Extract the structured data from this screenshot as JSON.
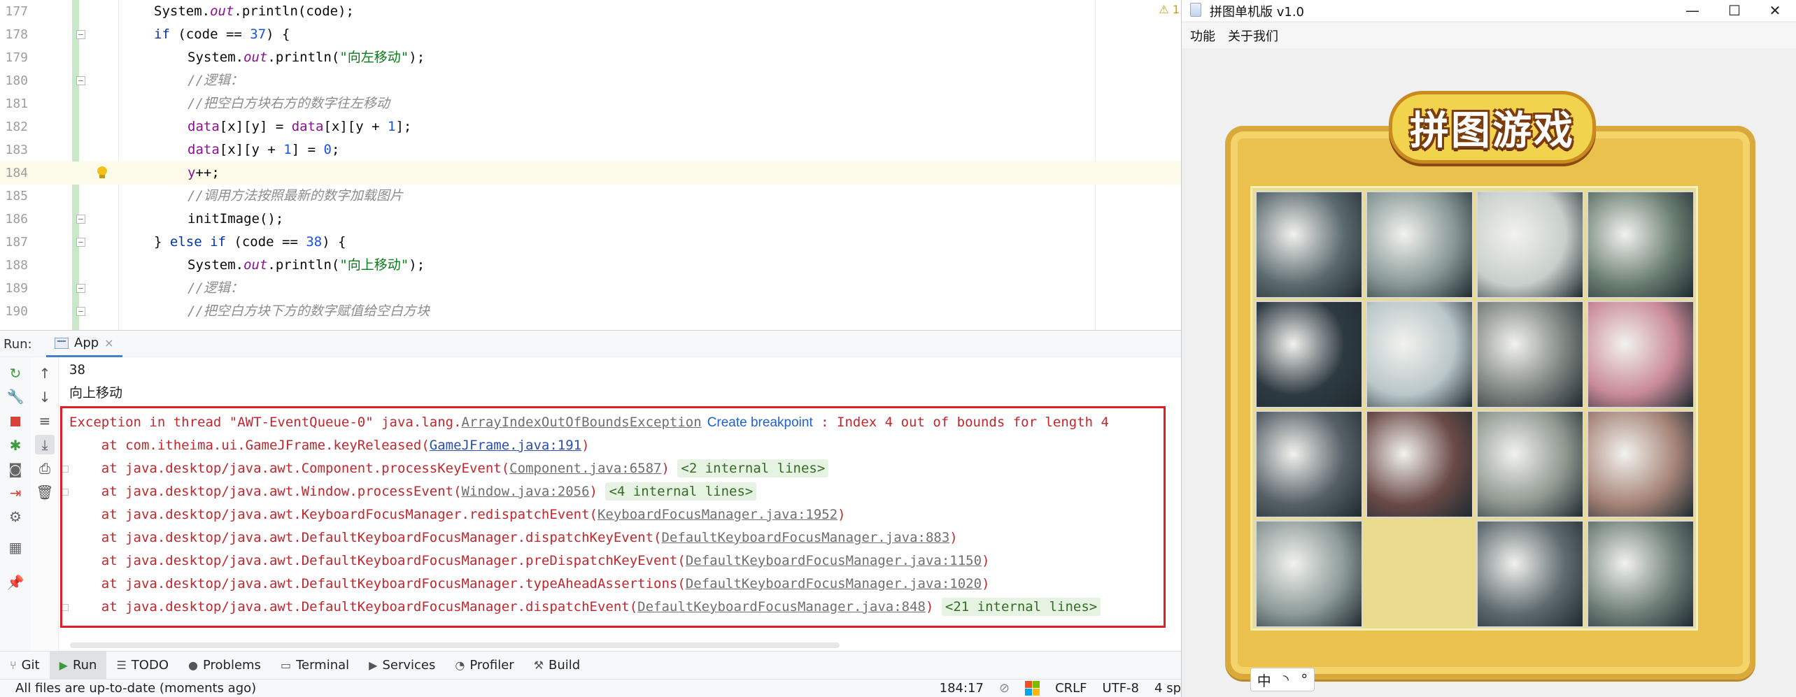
{
  "editor": {
    "lines": [
      {
        "no": "177",
        "indent": 1,
        "parts": [
          [
            "",
            "System."
          ],
          [
            "fld",
            "out"
          ],
          [
            "",
            ".println(code);"
          ]
        ]
      },
      {
        "no": "178",
        "indent": 1,
        "parts": [
          [
            "kw",
            "if"
          ],
          [
            "",
            " (code == "
          ],
          [
            "num",
            "37"
          ],
          [
            "",
            ") {"
          ]
        ],
        "fold": true
      },
      {
        "no": "179",
        "indent": 2,
        "parts": [
          [
            "",
            "System."
          ],
          [
            "fld",
            "out"
          ],
          [
            "",
            ".println("
          ],
          [
            "str",
            "\"向左移动\""
          ],
          [
            "",
            ");"
          ]
        ]
      },
      {
        "no": "180",
        "indent": 2,
        "parts": [
          [
            "cmt",
            "//逻辑："
          ]
        ],
        "fold": true
      },
      {
        "no": "181",
        "indent": 2,
        "parts": [
          [
            "cmt",
            "//把空白方块右方的数字往左移动"
          ]
        ]
      },
      {
        "no": "182",
        "indent": 2,
        "parts": [
          [
            "var",
            "data"
          ],
          [
            "",
            "[x][y] = "
          ],
          [
            "var",
            "data"
          ],
          [
            "",
            "[x][y + "
          ],
          [
            "num",
            "1"
          ],
          [
            "",
            "];"
          ]
        ]
      },
      {
        "no": "183",
        "indent": 2,
        "parts": [
          [
            "var",
            "data"
          ],
          [
            "",
            "[x][y + "
          ],
          [
            "num",
            "1"
          ],
          [
            "",
            "] = "
          ],
          [
            "num",
            "0"
          ],
          [
            "",
            ";"
          ]
        ]
      },
      {
        "no": "184",
        "indent": 2,
        "parts": [
          [
            "var",
            "y"
          ],
          [
            "",
            "++;"
          ]
        ],
        "highlight": true,
        "bulb": true
      },
      {
        "no": "185",
        "indent": 2,
        "parts": [
          [
            "cmt",
            "//调用方法按照最新的数字加载图片"
          ]
        ]
      },
      {
        "no": "186",
        "indent": 2,
        "parts": [
          [
            "",
            "initImage();"
          ]
        ],
        "fold": true
      },
      {
        "no": "187",
        "indent": 1,
        "parts": [
          [
            "",
            "} "
          ],
          [
            "kw",
            "else if"
          ],
          [
            "",
            " (code == "
          ],
          [
            "num",
            "38"
          ],
          [
            "",
            ") {"
          ]
        ],
        "fold": true
      },
      {
        "no": "188",
        "indent": 2,
        "parts": [
          [
            "",
            "System."
          ],
          [
            "fld",
            "out"
          ],
          [
            "",
            ".println("
          ],
          [
            "str",
            "\"向上移动\""
          ],
          [
            "",
            ");"
          ]
        ]
      },
      {
        "no": "189",
        "indent": 2,
        "parts": [
          [
            "cmt",
            "//逻辑："
          ]
        ],
        "fold": true
      },
      {
        "no": "190",
        "indent": 2,
        "parts": [
          [
            "cmt",
            "//把空白方块下方的数字赋值给空白方块"
          ]
        ],
        "fold": true
      }
    ],
    "warning_badge": "⚠ 1"
  },
  "run_panel": {
    "label": "Run:",
    "tab_label": "App",
    "close": "×"
  },
  "console": {
    "plain_lines": [
      "38",
      "向上移动"
    ],
    "exception": {
      "prefix": "Exception in thread \"AWT-EventQueue-0\" java.lang.",
      "exception_class": "ArrayIndexOutOfBoundsException",
      "create_breakpoint": "Create breakpoint",
      "message": " : Index 4 out of bounds for length 4"
    },
    "stack": [
      {
        "text": "    at com.itheima.ui.GameJFrame.keyReleased(",
        "link": "GameJFrame.java:191",
        "tail": ")",
        "internal": "",
        "blue": true
      },
      {
        "text": "    at java.desktop/java.awt.Component.processKeyEvent(",
        "link": "Component.java:6587",
        "tail": ") ",
        "internal": "<2 internal lines>",
        "fold": true
      },
      {
        "text": "    at java.desktop/java.awt.Window.processEvent(",
        "link": "Window.java:2056",
        "tail": ") ",
        "internal": "<4 internal lines>",
        "fold": true
      },
      {
        "text": "    at java.desktop/java.awt.KeyboardFocusManager.redispatchEvent(",
        "link": "KeyboardFocusManager.java:1952",
        "tail": ")",
        "internal": ""
      },
      {
        "text": "    at java.desktop/java.awt.DefaultKeyboardFocusManager.dispatchKeyEvent(",
        "link": "DefaultKeyboardFocusManager.java:883",
        "tail": ")",
        "internal": ""
      },
      {
        "text": "    at java.desktop/java.awt.DefaultKeyboardFocusManager.preDispatchKeyEvent(",
        "link": "DefaultKeyboardFocusManager.java:1150",
        "tail": ")",
        "internal": ""
      },
      {
        "text": "    at java.desktop/java.awt.DefaultKeyboardFocusManager.typeAheadAssertions(",
        "link": "DefaultKeyboardFocusManager.java:1020",
        "tail": ")",
        "internal": ""
      },
      {
        "text": "    at java.desktop/java.awt.DefaultKeyboardFocusManager.dispatchEvent(",
        "link": "DefaultKeyboardFocusManager.java:848",
        "tail": ") ",
        "internal": "<21 internal lines>",
        "fold": true
      }
    ]
  },
  "tool_tabs": [
    {
      "icon": "⑂",
      "label": "Git",
      "name": "git"
    },
    {
      "icon": "▶",
      "label": "Run",
      "name": "run",
      "active": true
    },
    {
      "icon": "☰",
      "label": "TODO",
      "name": "todo"
    },
    {
      "icon": "●",
      "label": "Problems",
      "name": "problems"
    },
    {
      "icon": "▭",
      "label": "Terminal",
      "name": "terminal"
    },
    {
      "icon": "▶",
      "label": "Services",
      "name": "services"
    },
    {
      "icon": "◔",
      "label": "Profiler",
      "name": "profiler"
    },
    {
      "icon": "⚒",
      "label": "Build",
      "name": "build"
    }
  ],
  "status_bar": {
    "message": "All files are up-to-date (moments ago)",
    "position": "184:17",
    "line_sep": "CRLF",
    "encoding": "UTF-8",
    "indent": "4 sp"
  },
  "game": {
    "title": "拼图单机版 v1.0",
    "menu": [
      "功能",
      "关于我们"
    ],
    "logo": "拼图游戏",
    "window_buttons": {
      "minimize": "—",
      "maximize": "☐",
      "close": "✕"
    },
    "ime": [
      "中",
      "◝",
      "°"
    ],
    "tiles": [
      [
        "#5b6a6e",
        "#879896",
        "#c8cfcb",
        "#6b7e72"
      ],
      [
        "#2e3a42",
        "#b9c6c8",
        "#7d8480",
        "#c98a98"
      ],
      [
        "#566067",
        "#6a4a47",
        "#8f9890",
        "#a68478"
      ],
      [
        "#8c9a98",
        "empty",
        "#5e6a6e",
        "#6f7f78"
      ]
    ]
  }
}
